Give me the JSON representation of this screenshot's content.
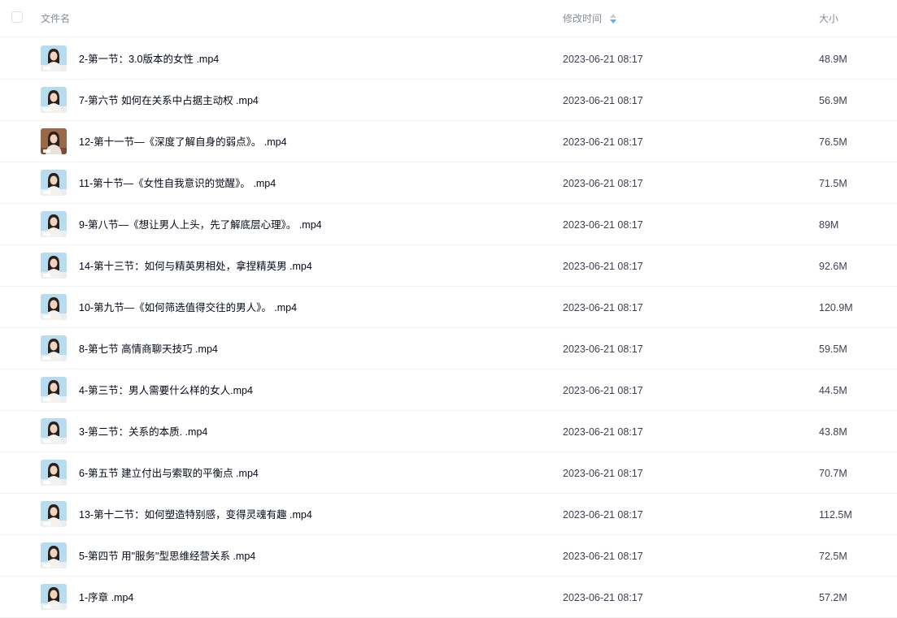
{
  "header": {
    "name_label": "文件名",
    "modified_label": "修改时间",
    "size_label": "大小"
  },
  "colors": {
    "sort_icon_active": "#5ab0f0",
    "sort_icon_inactive": "#c8ccd4",
    "thumb_light_bg": "#b7dcef",
    "thumb_dark_bg": "#9a6848"
  },
  "files": [
    {
      "name": "2-第一节：3.0版本的女性 .mp4",
      "modified": "2023-06-21 08:17",
      "size": "48.9M",
      "thumb": "light"
    },
    {
      "name": "7-第六节 如何在关系中占据主动权 .mp4",
      "modified": "2023-06-21 08:17",
      "size": "56.9M",
      "thumb": "light"
    },
    {
      "name": "12-第十一节—《深度了解自身的弱点》。 .mp4",
      "modified": "2023-06-21 08:17",
      "size": "76.5M",
      "thumb": "dark"
    },
    {
      "name": "11-第十节—《女性自我意识的觉醒》。 .mp4",
      "modified": "2023-06-21 08:17",
      "size": "71.5M",
      "thumb": "light"
    },
    {
      "name": "9-第八节—《想让男人上头，先了解底层心理》。 .mp4",
      "modified": "2023-06-21 08:17",
      "size": "89M",
      "thumb": "light"
    },
    {
      "name": "14-第十三节：如何与精英男相处，拿捏精英男 .mp4",
      "modified": "2023-06-21 08:17",
      "size": "92.6M",
      "thumb": "light"
    },
    {
      "name": "10-第九节—《如何筛选值得交往的男人》。 .mp4",
      "modified": "2023-06-21 08:17",
      "size": "120.9M",
      "thumb": "light"
    },
    {
      "name": "8-第七节 高情商聊天技巧 .mp4",
      "modified": "2023-06-21 08:17",
      "size": "59.5M",
      "thumb": "light"
    },
    {
      "name": "4-第三节：男人需要什么样的女人.mp4",
      "modified": "2023-06-21 08:17",
      "size": "44.5M",
      "thumb": "light"
    },
    {
      "name": "3-第二节：关系的本质. .mp4",
      "modified": "2023-06-21 08:17",
      "size": "43.8M",
      "thumb": "light"
    },
    {
      "name": "6-第五节 建立付出与索取的平衡点 .mp4",
      "modified": "2023-06-21 08:17",
      "size": "70.7M",
      "thumb": "light"
    },
    {
      "name": "13-第十二节：如何塑造特别感，变得灵魂有趣 .mp4",
      "modified": "2023-06-21 08:17",
      "size": "112.5M",
      "thumb": "light"
    },
    {
      "name": "5-第四节 用\"服务\"型思维经营关系 .mp4",
      "modified": "2023-06-21 08:17",
      "size": "72.5M",
      "thumb": "light"
    },
    {
      "name": "1-序章 .mp4",
      "modified": "2023-06-21 08:17",
      "size": "57.2M",
      "thumb": "light"
    }
  ]
}
